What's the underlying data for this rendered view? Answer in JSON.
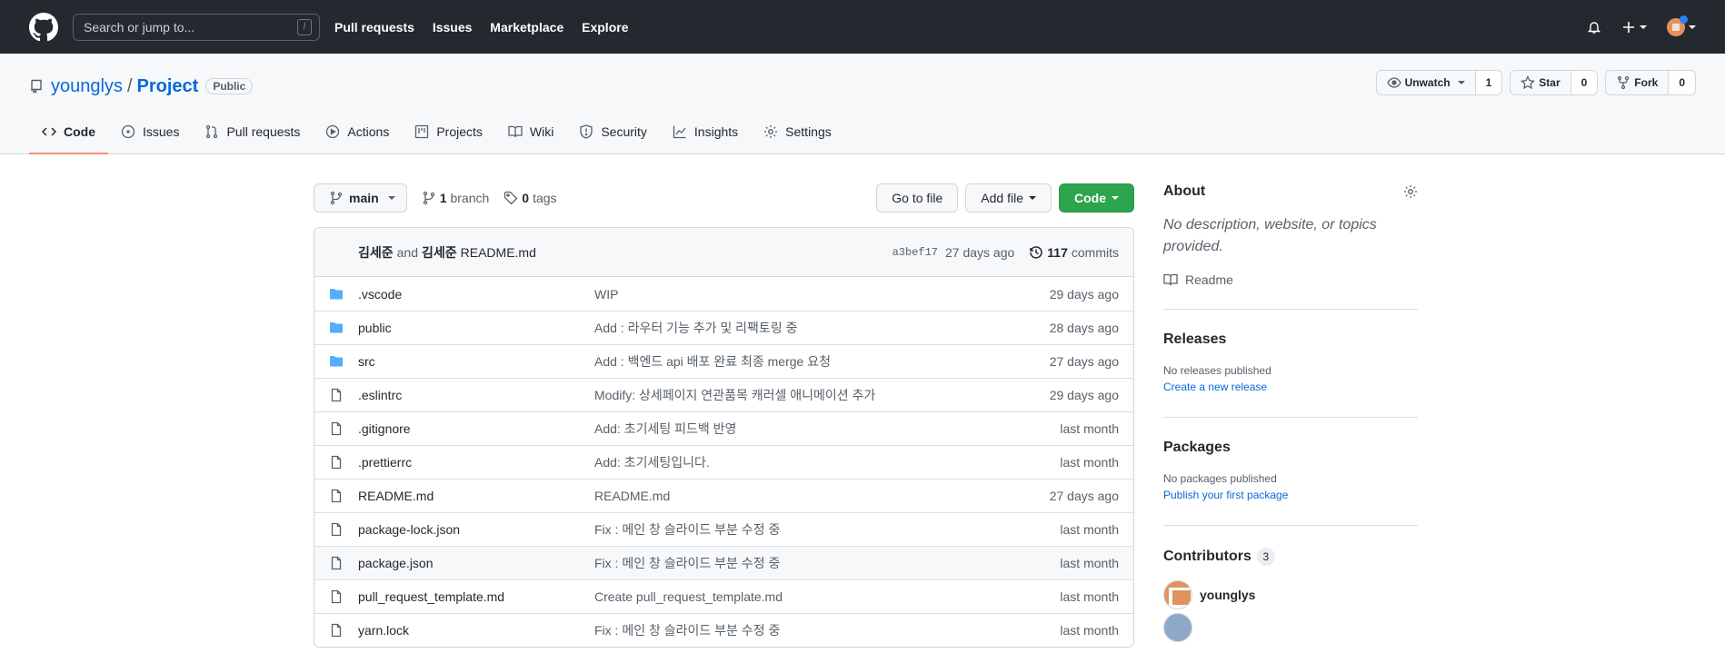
{
  "header": {
    "search_placeholder": "Search or jump to...",
    "search_shortcut": "/",
    "nav": [
      "Pull requests",
      "Issues",
      "Marketplace",
      "Explore"
    ]
  },
  "repo": {
    "owner": "younglys",
    "separator": "/",
    "name": "Project",
    "visibility": "Public",
    "watch_label": "Unwatch",
    "watch_count": "1",
    "star_label": "Star",
    "star_count": "0",
    "fork_label": "Fork",
    "fork_count": "0",
    "tabs": [
      {
        "label": "Code",
        "icon": "code-icon",
        "active": true
      },
      {
        "label": "Issues",
        "icon": "issue-opened-icon"
      },
      {
        "label": "Pull requests",
        "icon": "git-pull-request-icon"
      },
      {
        "label": "Actions",
        "icon": "play-icon"
      },
      {
        "label": "Projects",
        "icon": "project-icon"
      },
      {
        "label": "Wiki",
        "icon": "book-icon"
      },
      {
        "label": "Security",
        "icon": "shield-icon"
      },
      {
        "label": "Insights",
        "icon": "graph-icon"
      },
      {
        "label": "Settings",
        "icon": "gear-icon"
      }
    ]
  },
  "file_nav": {
    "branch": "main",
    "branch_count": "1",
    "branch_label": "branch",
    "tag_count": "0",
    "tag_label": "tags",
    "go_to_file": "Go to file",
    "add_file": "Add file",
    "code": "Code"
  },
  "commit": {
    "author1": "김세준",
    "and": "and",
    "author2": "김세준",
    "message": "README.md",
    "sha": "a3bef17",
    "age": "27 days ago",
    "count": "117",
    "count_label": "commits"
  },
  "files": [
    {
      "type": "dir",
      "name": ".vscode",
      "message": "WIP",
      "age": "29 days ago"
    },
    {
      "type": "dir",
      "name": "public",
      "message": "Add : 라우터 기능 추가 및 리팩토링 중",
      "age": "28 days ago"
    },
    {
      "type": "dir",
      "name": "src",
      "message": "Add : 백엔드 api 배포 완료 최종 merge 요청",
      "age": "27 days ago"
    },
    {
      "type": "file",
      "name": ".eslintrc",
      "message": "Modify: 상세페이지 연관품목 캐러셀 애니메이션 추가",
      "age": "29 days ago"
    },
    {
      "type": "file",
      "name": ".gitignore",
      "message": "Add: 초기세팅 피드백 반영",
      "age": "last month"
    },
    {
      "type": "file",
      "name": ".prettierrc",
      "message": "Add: 초기세팅입니다.",
      "age": "last month"
    },
    {
      "type": "file",
      "name": "README.md",
      "message": "README.md",
      "age": "27 days ago"
    },
    {
      "type": "file",
      "name": "package-lock.json",
      "message": "Fix : 메인 창 슬라이드 부분 수정 중",
      "age": "last month"
    },
    {
      "type": "file",
      "name": "package.json",
      "message": "Fix : 메인 창 슬라이드 부분 수정 중",
      "age": "last month"
    },
    {
      "type": "file",
      "name": "pull_request_template.md",
      "message": "Create pull_request_template.md",
      "age": "last month"
    },
    {
      "type": "file",
      "name": "yarn.lock",
      "message": "Fix : 메인 창 슬라이드 부분 수정 중",
      "age": "last month"
    }
  ],
  "sidebar": {
    "about_title": "About",
    "about_desc": "No description, website, or topics provided.",
    "readme": "Readme",
    "releases_title": "Releases",
    "releases_text": "No releases published",
    "releases_link": "Create a new release",
    "packages_title": "Packages",
    "packages_text": "No packages published",
    "packages_link": "Publish your first package",
    "contributors_title": "Contributors",
    "contributors_count": "3",
    "contributors": [
      {
        "name": "younglys"
      },
      {
        "name": ""
      }
    ]
  },
  "colors": {
    "header_bg": "#24292f",
    "link": "#0969da",
    "primary_button": "#2da44e",
    "active_tab_underline": "#fd8c73",
    "folder_icon": "#54aeff"
  }
}
